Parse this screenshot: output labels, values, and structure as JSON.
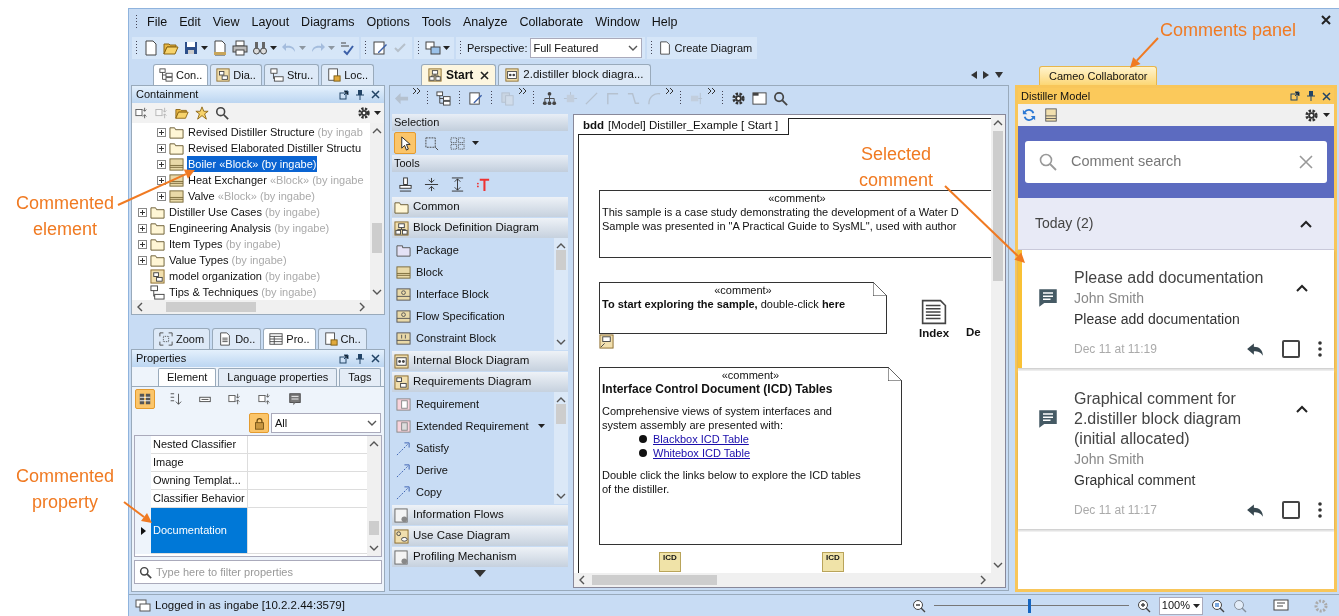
{
  "menu_bar": [
    "File",
    "Edit",
    "View",
    "Layout",
    "Diagrams",
    "Options",
    "Tools",
    "Analyze",
    "Collaborate",
    "Window",
    "Help"
  ],
  "main_toolbar": {
    "groups": [
      [
        {
          "kind": "new",
          "disabled": false,
          "dropdown": false
        },
        {
          "kind": "open",
          "disabled": false,
          "dropdown": false
        },
        {
          "kind": "save",
          "disabled": false,
          "dropdown": true
        },
        {
          "kind": "page",
          "disabled": false,
          "dropdown": false
        },
        {
          "kind": "print",
          "disabled": false,
          "dropdown": false
        },
        {
          "kind": "find",
          "disabled": false,
          "dropdown": true
        },
        {
          "kind": "undo",
          "disabled": true,
          "dropdown": true
        },
        {
          "kind": "redo",
          "disabled": true,
          "dropdown": true
        },
        {
          "kind": "spell",
          "disabled": false,
          "dropdown": false
        }
      ],
      [
        {
          "kind": "edit",
          "disabled": false,
          "dropdown": false
        },
        {
          "kind": "check",
          "disabled": true,
          "dropdown": false
        }
      ],
      [
        {
          "kind": "layout",
          "disabled": false,
          "dropdown": true
        }
      ]
    ],
    "perspective_label": "Perspective:",
    "perspective_value": "Full Featured",
    "create_diagram": "Create Diagram"
  },
  "browser_tabs": [
    {
      "label": "Con..",
      "kind": "tree",
      "selected": true
    },
    {
      "label": "Dia..",
      "kind": "diagram",
      "selected": false
    },
    {
      "label": "Stru..",
      "kind": "structure",
      "selected": false
    },
    {
      "label": "Loc..",
      "kind": "lock-doc",
      "selected": false
    }
  ],
  "containment": {
    "title": "Containment",
    "toolbar": [
      {
        "kind": "collapse",
        "disabled": false
      },
      {
        "kind": "expand",
        "disabled": true
      },
      {
        "kind": "open",
        "disabled": false
      },
      {
        "kind": "star",
        "disabled": false
      },
      {
        "kind": "search",
        "disabled": false
      }
    ],
    "tree": [
      {
        "children": [
          {
            "label": "Revised Distiller Structure",
            "owner": "(by ingab",
            "kind": "folder",
            "expandable": true,
            "selected": false
          },
          {
            "label": "Revised Elaborated  Distiller Structu",
            "kind": "folder",
            "expandable": true,
            "selected": false
          },
          {
            "label": "Boiler",
            "stereotype": "«Block»",
            "owner": "(by ingabe)",
            "kind": "block",
            "expandable": true,
            "selected": true
          },
          {
            "label": "Heat Exchanger",
            "stereotype": "«Block»",
            "owner": "(by ingabe",
            "kind": "block",
            "expandable": true,
            "selected": false
          },
          {
            "label": "Valve",
            "stereotype": "«Block»",
            "owner": "(by ingabe)",
            "kind": "block",
            "expandable": true,
            "selected": false
          }
        ]
      },
      {
        "label": "Distiller Use Cases",
        "owner": "(by ingabe)",
        "kind": "folder",
        "expandable": true,
        "selected": false
      },
      {
        "label": "Engineering Analysis",
        "owner": "(by ingabe)",
        "kind": "folder",
        "expandable": true,
        "selected": false
      },
      {
        "label": "Item Types",
        "owner": "(by ingabe)",
        "kind": "folder",
        "expandable": true,
        "selected": false
      },
      {
        "label": "Value Types",
        "owner": "(by ingabe)",
        "kind": "folder",
        "expandable": true,
        "selected": false
      },
      {
        "label": "model organization",
        "owner": "(by ingabe)",
        "kind": "diagram",
        "expandable": false,
        "selected": false
      },
      {
        "label": "Tips & Techniques",
        "owner": "(by ingabe)",
        "kind": "structure",
        "expandable": false,
        "selected": false
      }
    ]
  },
  "lower_tabs": [
    {
      "label": "Zoom",
      "kind": "zoom",
      "selected": false
    },
    {
      "label": "Do..",
      "kind": "doc",
      "selected": false
    },
    {
      "label": "Pro..",
      "kind": "table",
      "selected": true
    },
    {
      "label": "Ch..",
      "kind": "lock-doc",
      "selected": false
    }
  ],
  "properties": {
    "title": "Properties",
    "tabs": [
      {
        "label": "Element",
        "selected": true
      },
      {
        "label": "Language properties",
        "selected": false
      },
      {
        "label": "Tags",
        "selected": false
      }
    ],
    "toolbar": [
      {
        "kind": "grouped",
        "selected": true
      },
      {
        "kind": "sort",
        "selected": false
      },
      {
        "kind": "compact",
        "selected": false
      },
      {
        "kind": "expand",
        "selected": false
      },
      {
        "kind": "collapse",
        "selected": false
      },
      {
        "kind": "notes",
        "selected": false
      }
    ],
    "lock_on": true,
    "filter": "All",
    "rows": [
      {
        "name": "Nested Classifier",
        "selected": false
      },
      {
        "name": "Image",
        "selected": false
      },
      {
        "name": "Owning Templat...",
        "selected": false
      },
      {
        "name": "Classifier Behavior",
        "selected": false
      },
      {
        "name": "Documentation",
        "selected": true
      }
    ],
    "search_placeholder": "Type here to filter properties"
  },
  "diagram_tabs": [
    {
      "label": "Start",
      "kind": "bdd",
      "selected": true,
      "closable": true
    },
    {
      "label": "2.distiller block diagra...",
      "kind": "ibd",
      "selected": false,
      "closable": false
    }
  ],
  "diagram_toolbar": [
    {
      "kind": "back",
      "disabled": true
    },
    {
      "kind": "tree",
      "disabled": false
    },
    {
      "kind": "edit",
      "disabled": false
    },
    {
      "kind": "copy",
      "disabled": true
    },
    {
      "kind": "hierarchy",
      "disabled": false
    },
    {
      "kind": "node",
      "disabled": true
    },
    {
      "kind": "line",
      "disabled": true
    },
    {
      "kind": "elbow",
      "disabled": true
    },
    {
      "kind": "poly",
      "disabled": true
    },
    {
      "kind": "curve",
      "disabled": true
    },
    {
      "kind": "align",
      "disabled": true
    },
    {
      "kind": "gear",
      "disabled": false
    },
    {
      "kind": "frame",
      "disabled": false
    },
    {
      "kind": "search",
      "disabled": false
    }
  ],
  "palette": {
    "blocks": [
      {
        "kind": "label",
        "text": "Selection"
      },
      {
        "kind": "icons",
        "icons": [
          {
            "kind": "pointer",
            "selected": true
          },
          {
            "kind": "marquee",
            "selected": false
          },
          {
            "kind": "multi",
            "selected": false
          }
        ]
      },
      {
        "kind": "label",
        "text": "Tools"
      },
      {
        "kind": "icons",
        "icons": [
          {
            "kind": "stamp",
            "selected": false
          },
          {
            "kind": "spacer",
            "selected": false
          },
          {
            "kind": "spacer2",
            "selected": false
          },
          {
            "kind": "text",
            "selected": false
          }
        ]
      },
      {
        "kind": "group",
        "text": "Common"
      },
      {
        "kind": "group",
        "text": "Block Definition Diagram",
        "items": [
          {
            "text": "Package",
            "kind": "package"
          },
          {
            "text": "Block",
            "kind": "block"
          },
          {
            "text": "Interface Block",
            "kind": "iblock"
          },
          {
            "text": "Flow Specification",
            "kind": "iblock"
          },
          {
            "text": "Constraint Block",
            "kind": "cblock"
          }
        ]
      },
      {
        "kind": "group",
        "text": "Internal Block Diagram"
      },
      {
        "kind": "group",
        "text": "Requirements Diagram",
        "items": [
          {
            "text": "Requirement",
            "kind": "req-r"
          },
          {
            "text": "Extended Requirement",
            "kind": "req-e",
            "dropdown": true
          },
          {
            "text": "Satisfy",
            "kind": "dep"
          },
          {
            "text": "Derive",
            "kind": "dep"
          },
          {
            "text": "Copy",
            "kind": "dep"
          }
        ]
      },
      {
        "kind": "group",
        "text": "Information Flows"
      },
      {
        "kind": "group",
        "text": "Use Case Diagram"
      },
      {
        "kind": "group",
        "text": "Profiling Mechanism"
      }
    ]
  },
  "diagram": {
    "frame_kind": "bdd",
    "frame_label": "[Model] Distiller_Example [ Start ]",
    "comments": [
      {
        "stereotype": "«comment»",
        "content": [
          {
            "kind": "text",
            "text": "This sample is a case study demonstrating the development of a Water D"
          },
          {
            "kind": "text",
            "text": "Sample was presented in \"A Practical Guide to SysML\", used with author"
          }
        ]
      },
      {
        "stereotype": "«comment»",
        "folded": true,
        "content": [
          {
            "kind": "text",
            "text": "**To start exploring the sample,** double-click **here**"
          }
        ]
      },
      {
        "stereotype": "«comment»",
        "folded": true,
        "content": [
          {
            "kind": "title",
            "text": "Interface Control Document (ICD) Tables"
          },
          {
            "kind": "text",
            "text": "Comprehensive views of system interfaces and system assembly are presented with:"
          },
          {
            "kind": "link",
            "text": "Blackbox ICD Table"
          },
          {
            "kind": "link",
            "text": "Whitebox ICD Table"
          },
          {
            "kind": "text",
            "text": "Double click the links below to explore the ICD tables of the distiller."
          }
        ]
      }
    ],
    "shapes": [
      {
        "kind": "document",
        "label": "Index"
      },
      {
        "kind": "hidden",
        "label": "De"
      },
      {
        "kind": "icd",
        "label": "ICD"
      },
      {
        "kind": "icd",
        "label": "ICD"
      }
    ]
  },
  "comments_panel": {
    "tab": "Cameo Collaborator",
    "title": "Distiller Model",
    "search_placeholder": "Comment search",
    "groups": [
      {
        "label": "Today (2)",
        "expanded": true,
        "comments": [
          {
            "title": "Please add documentation",
            "author": "John Smith",
            "body": "Please add documentation",
            "date": "Dec 11 at 11:19",
            "selected": true,
            "resolved": false,
            "expanded": true
          },
          {
            "title": "Graphical comment for 2.distiller block diagram (initial allocated)",
            "author": "John Smith",
            "body": "Graphical comment",
            "date": "Dec 11 at 11:17",
            "selected": false,
            "resolved": false,
            "expanded": true
          }
        ]
      }
    ]
  },
  "status_bar": {
    "text": "Logged in as ingabe [10.2.2.44:3579]",
    "zoom": {
      "level": 0.49,
      "value": "100%"
    }
  },
  "annotations": [
    {
      "text": "Comments panel"
    },
    {
      "text": "Selected comment"
    },
    {
      "text": "Commented element"
    },
    {
      "text": "Commented property"
    }
  ]
}
